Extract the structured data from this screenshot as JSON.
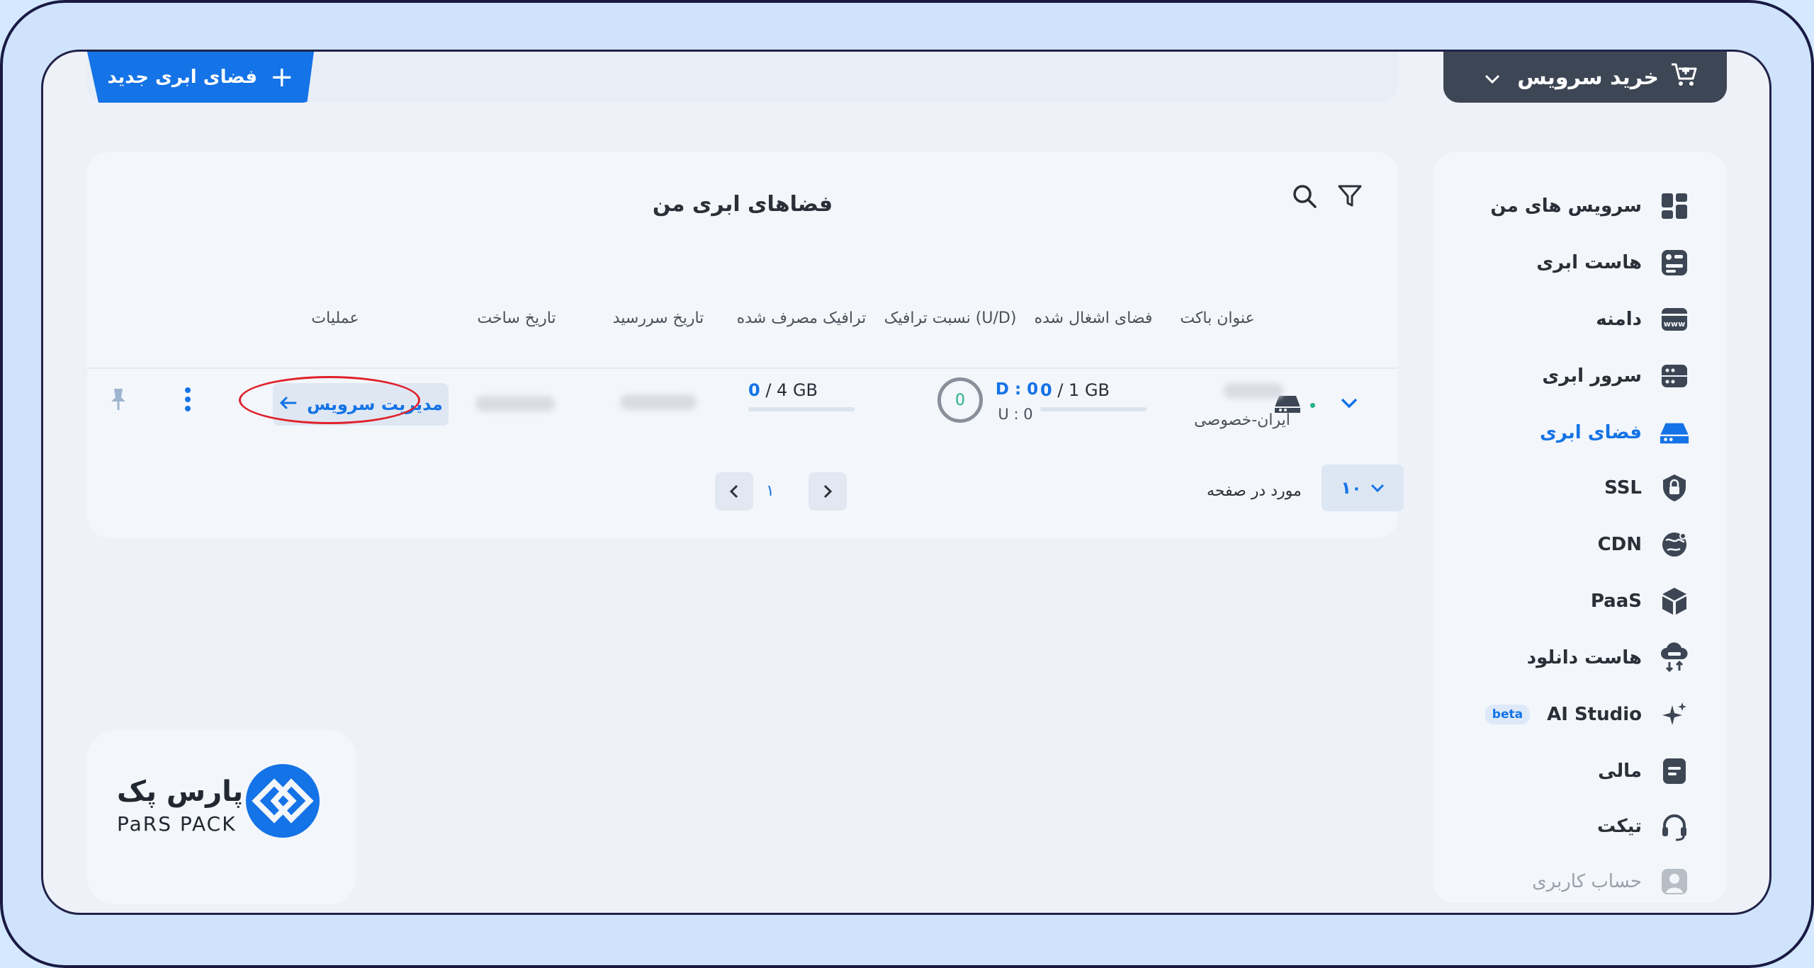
{
  "topbar": {
    "new_space_label": "فضای ابری جدید",
    "buy_service_label": "خرید سرویس"
  },
  "sidebar": {
    "items": [
      {
        "label": "سرویس های من",
        "icon": "dashboard-icon"
      },
      {
        "label": "هاست ابری",
        "icon": "cloud-host-icon"
      },
      {
        "label": "دامنه",
        "icon": "domain-icon"
      },
      {
        "label": "سرور ابری",
        "icon": "server-icon"
      },
      {
        "label": "فضای ابری",
        "icon": "cloud-storage-icon",
        "active": true
      },
      {
        "label": "SSL",
        "icon": "lock-shield-icon"
      },
      {
        "label": "CDN",
        "icon": "globe-icon"
      },
      {
        "label": "PaaS",
        "icon": "box-icon"
      },
      {
        "label": "هاست دانلود",
        "icon": "cloud-download-icon"
      },
      {
        "label": "AI Studio",
        "icon": "sparkle-icon",
        "badge": "beta"
      },
      {
        "label": "مالی",
        "icon": "finance-icon"
      },
      {
        "label": "تیکت",
        "icon": "headset-icon"
      },
      {
        "label": "حساب کاربری",
        "icon": "user-icon",
        "disabled": true
      }
    ]
  },
  "card": {
    "title": "فضاهای ابری من",
    "columns": {
      "bucket_title": "عنوان باکت",
      "used_space": "فضای اشغال شده",
      "traffic_ratio": "نسبت ترافیک (U/D)",
      "traffic_used": "ترافیک مصرف شده",
      "expiry_date": "تاریخ سررسید",
      "created_date": "تاریخ ساخت",
      "operations": "عملیات"
    },
    "row": {
      "location": "ایران-خصوصی",
      "used_space_value": "0",
      "used_space_total": "/ 1 GB",
      "ratio_gauge": "0",
      "download": "D : 0",
      "upload": "U : 0",
      "traffic_value": "0",
      "traffic_total": "/ 4 GB",
      "manage_label": "مدیریت سرویس"
    },
    "pagination": {
      "page": "۱",
      "per_page_value": "۱۰",
      "per_page_label": "مورد در صفحه"
    }
  },
  "logo": {
    "fa_text": "پارس پک",
    "en_text": "PaRS PACK"
  },
  "colors": {
    "accent": "#1473e6",
    "dark_button": "#3d4654",
    "highlight_ring": "#e0202a"
  }
}
